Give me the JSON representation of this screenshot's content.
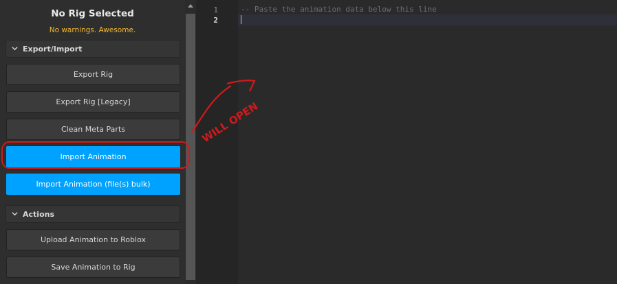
{
  "panel": {
    "title": "No Rig Selected",
    "subtitle": "No warnings. Awesome.",
    "colors": {
      "warning": "#f5b72e",
      "primary": "#00a2ff"
    },
    "sections": [
      {
        "label": "Export/Import",
        "buttons": [
          {
            "label": "Export Rig",
            "primary": false
          },
          {
            "label": "Export Rig [Legacy]",
            "primary": false
          },
          {
            "label": "Clean Meta Parts",
            "primary": false
          },
          {
            "label": "Import Animation",
            "primary": true
          },
          {
            "label": "Import Animation (file(s) bulk)",
            "primary": true
          }
        ]
      },
      {
        "label": "Actions",
        "buttons": [
          {
            "label": "Upload Animation to Roblox",
            "primary": false
          },
          {
            "label": "Save Animation to Rig",
            "primary": false
          }
        ]
      }
    ]
  },
  "editor": {
    "line_numbers": [
      "1",
      "2"
    ],
    "line1": "-- Paste the animation data below this line",
    "line2": ""
  },
  "annotation": {
    "text": "WILL OPEN",
    "color": "#d11a1a"
  }
}
